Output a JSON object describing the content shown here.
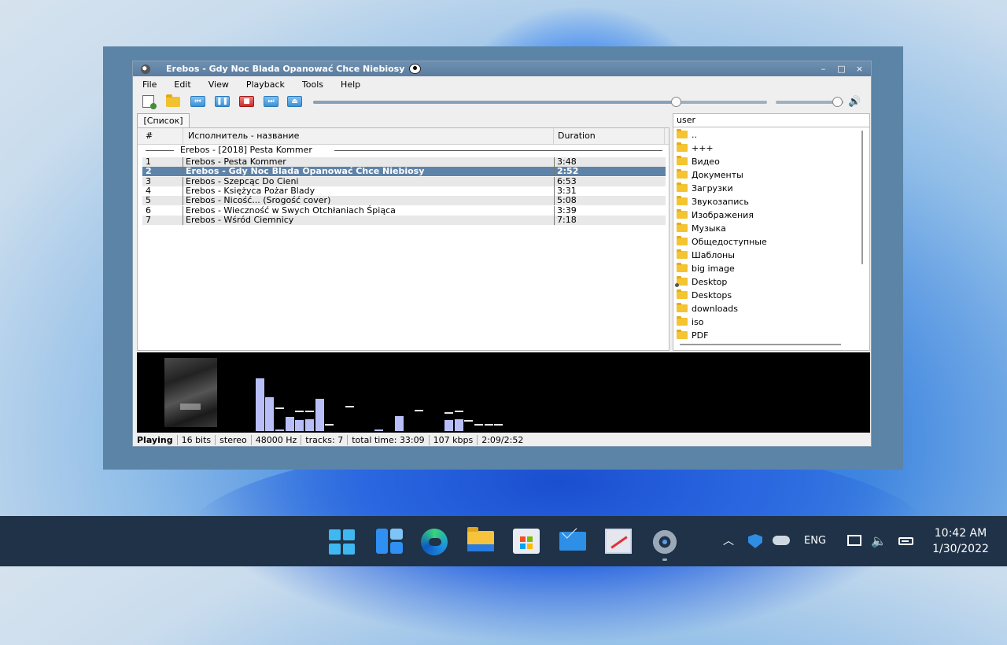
{
  "window": {
    "title": "Erebos - Gdy Noc Blada Opanować Chce Niebiosy",
    "controls": [
      "–",
      "□",
      "×"
    ]
  },
  "menu": [
    "File",
    "Edit",
    "View",
    "Playback",
    "Tools",
    "Help"
  ],
  "toolbar": {
    "icons": [
      "new-playlist-icon",
      "open-folder-icon",
      "previous-icon",
      "pause-icon",
      "stop-icon",
      "next-icon",
      "eject-icon"
    ],
    "seek_position": 0.8,
    "volume_level": 0.92
  },
  "playlist": {
    "tab": "[Список]",
    "columns": {
      "num": "#",
      "title": "Исполнитель - название",
      "duration": "Duration"
    },
    "group": "Erebos - [2018] Pesta Kommer",
    "selected_index": 1,
    "tracks": [
      {
        "num": "1",
        "title": "Erebos - Pesta Kommer",
        "duration": "3:48"
      },
      {
        "num": "2",
        "title": "Erebos - Gdy Noc Blada Opanować Chce Niebiosy",
        "duration": "2:52"
      },
      {
        "num": "3",
        "title": "Erebos - Szepcąc Do Cieni",
        "duration": "6:53"
      },
      {
        "num": "4",
        "title": "Erebos - Księżyca Pożar Blady",
        "duration": "3:31"
      },
      {
        "num": "5",
        "title": "Erebos - Nicość... (Srogość cover)",
        "duration": "5:08"
      },
      {
        "num": "6",
        "title": "Erebos - Wieczność w Swych Otchłaniach Śpiąca",
        "duration": "3:39"
      },
      {
        "num": "7",
        "title": "Erebos - Wśród Ciemnicy",
        "duration": "7:18"
      }
    ]
  },
  "files": {
    "header": "user",
    "items": [
      "..",
      "+++",
      "Видео",
      "Документы",
      "Загрузки",
      "Звукозапись",
      "Изображения",
      "Музыка",
      "Общедоступные",
      "Шаблоны",
      "big image",
      "Desktop",
      "Desktops",
      "downloads",
      "iso",
      "PDF"
    ]
  },
  "spectrum": {
    "bars": [
      0.0,
      0.67,
      0.43,
      0.02,
      0.18,
      0.14,
      0.15,
      0.41,
      0.0,
      0.0,
      0.0,
      0.0,
      0.0,
      0.02,
      0.0,
      0.19,
      0.0,
      0.0,
      0.0,
      0.0,
      0.14,
      0.15,
      0.0,
      0.0,
      0.0,
      0.0,
      0.0
    ],
    "peaks": [
      0.0,
      0.67,
      0.43,
      0.28,
      0.18,
      0.24,
      0.24,
      0.41,
      0.07,
      0.0,
      0.3,
      0.0,
      0.0,
      0.02,
      0.0,
      0.19,
      0.0,
      0.25,
      0.0,
      0.0,
      0.22,
      0.24,
      0.12,
      0.07,
      0.07,
      0.07,
      0.0
    ]
  },
  "status": [
    "Playing",
    "16 bits",
    "stereo",
    "48000 Hz",
    "tracks: 7",
    "total time: 33:09",
    "107 kbps",
    "2:09/2:52"
  ],
  "taskbar": {
    "apps": [
      "start-icon",
      "widgets-icon",
      "edge-icon",
      "file-explorer-icon",
      "store-icon",
      "mail-icon",
      "app-icon",
      "settings-icon"
    ],
    "tray": {
      "lang": "ENG",
      "time": "10:42 AM",
      "date": "1/30/2022"
    },
    "accent": "#3fb8f2"
  }
}
